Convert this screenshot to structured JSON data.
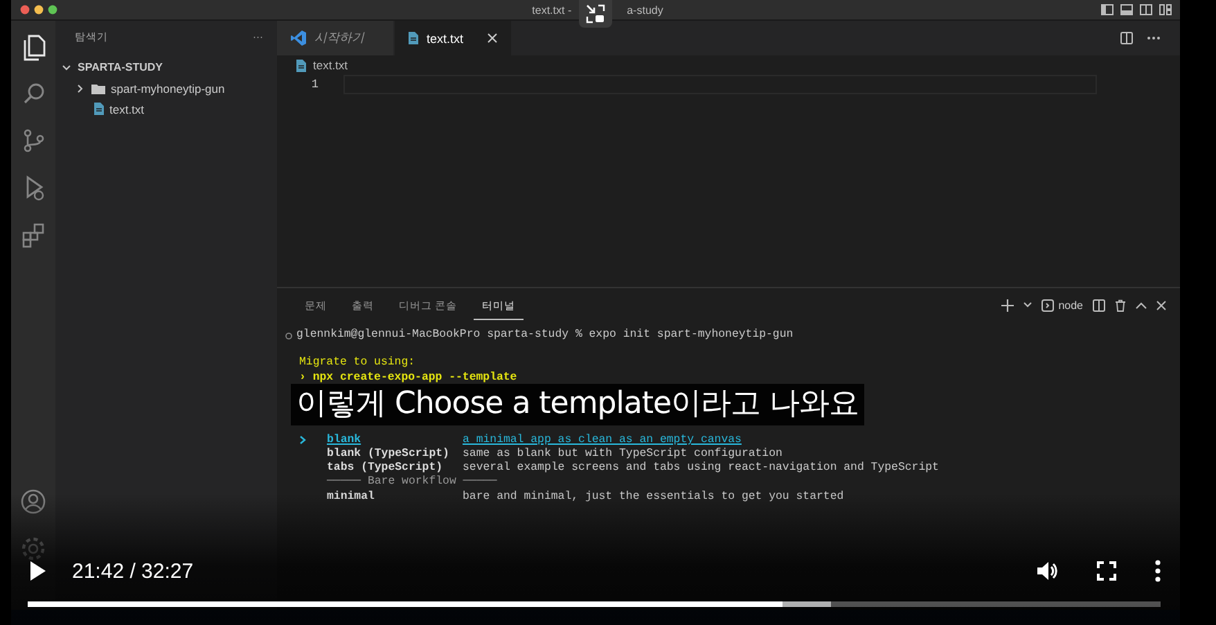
{
  "window": {
    "title_parts": [
      "text.txt -",
      "a-study"
    ]
  },
  "activity_bar": {
    "items": [
      {
        "kind": "files",
        "selected": true
      },
      {
        "kind": "search",
        "selected": false
      },
      {
        "kind": "source-control",
        "selected": false
      },
      {
        "kind": "run",
        "selected": false
      },
      {
        "kind": "extensions",
        "selected": false
      }
    ],
    "bottom": [
      {
        "kind": "account"
      },
      {
        "kind": "settings"
      }
    ]
  },
  "sidebar": {
    "title": "탐색기",
    "more": "···",
    "root": {
      "label": "SPARTA-STUDY",
      "expanded": true,
      "children": [
        {
          "kind": "folder",
          "label": "spart-myhoneytip-gun",
          "expanded": false
        },
        {
          "kind": "file",
          "label": "text.txt"
        }
      ]
    }
  },
  "editor": {
    "tabs": [
      {
        "kind": "welcome",
        "label": "시작하기",
        "selected": false
      },
      {
        "kind": "file",
        "label": "text.txt",
        "selected": true
      }
    ],
    "breadcrumb": "text.txt",
    "line_numbers": [
      "1"
    ]
  },
  "panel": {
    "tabs": [
      {
        "label": "문제",
        "selected": false
      },
      {
        "label": "출력",
        "selected": false
      },
      {
        "label": "디버그 콘솔",
        "selected": false
      },
      {
        "label": "터미널",
        "selected": true
      }
    ],
    "terminal_name": "node",
    "lines": [
      {
        "kind": "prompt",
        "text": "glennkim@glennui-MacBookPro sparta-study % expo init spart-myhoneytip-gun"
      },
      {
        "kind": "notice",
        "text": "Migrate to using:"
      },
      {
        "kind": "command",
        "text": "› npx create-expo-app --template"
      }
    ],
    "options": [
      {
        "kind": "option",
        "name": "blank",
        "description": "a minimal app as clean as an empty canvas",
        "selected": true
      },
      {
        "kind": "option",
        "name": "blank (TypeScript)",
        "description": "same as blank but with TypeScript configuration",
        "selected": false
      },
      {
        "kind": "option",
        "name": "tabs (TypeScript)",
        "description": "several example screens and tabs using react-navigation and TypeScript",
        "selected": false
      },
      {
        "kind": "separator",
        "text": "───── Bare workflow ─────"
      },
      {
        "kind": "option",
        "name": "minimal",
        "description": "bare and minimal, just the essentials to get you started",
        "selected": false
      }
    ]
  },
  "subtitle": "이렇게 Choose a template이라고 나와요",
  "player": {
    "playing": false,
    "time": "21:42 / 32:27",
    "progress": {
      "level": 0.666,
      "buffer": {
        "level": 0.709
      }
    }
  }
}
